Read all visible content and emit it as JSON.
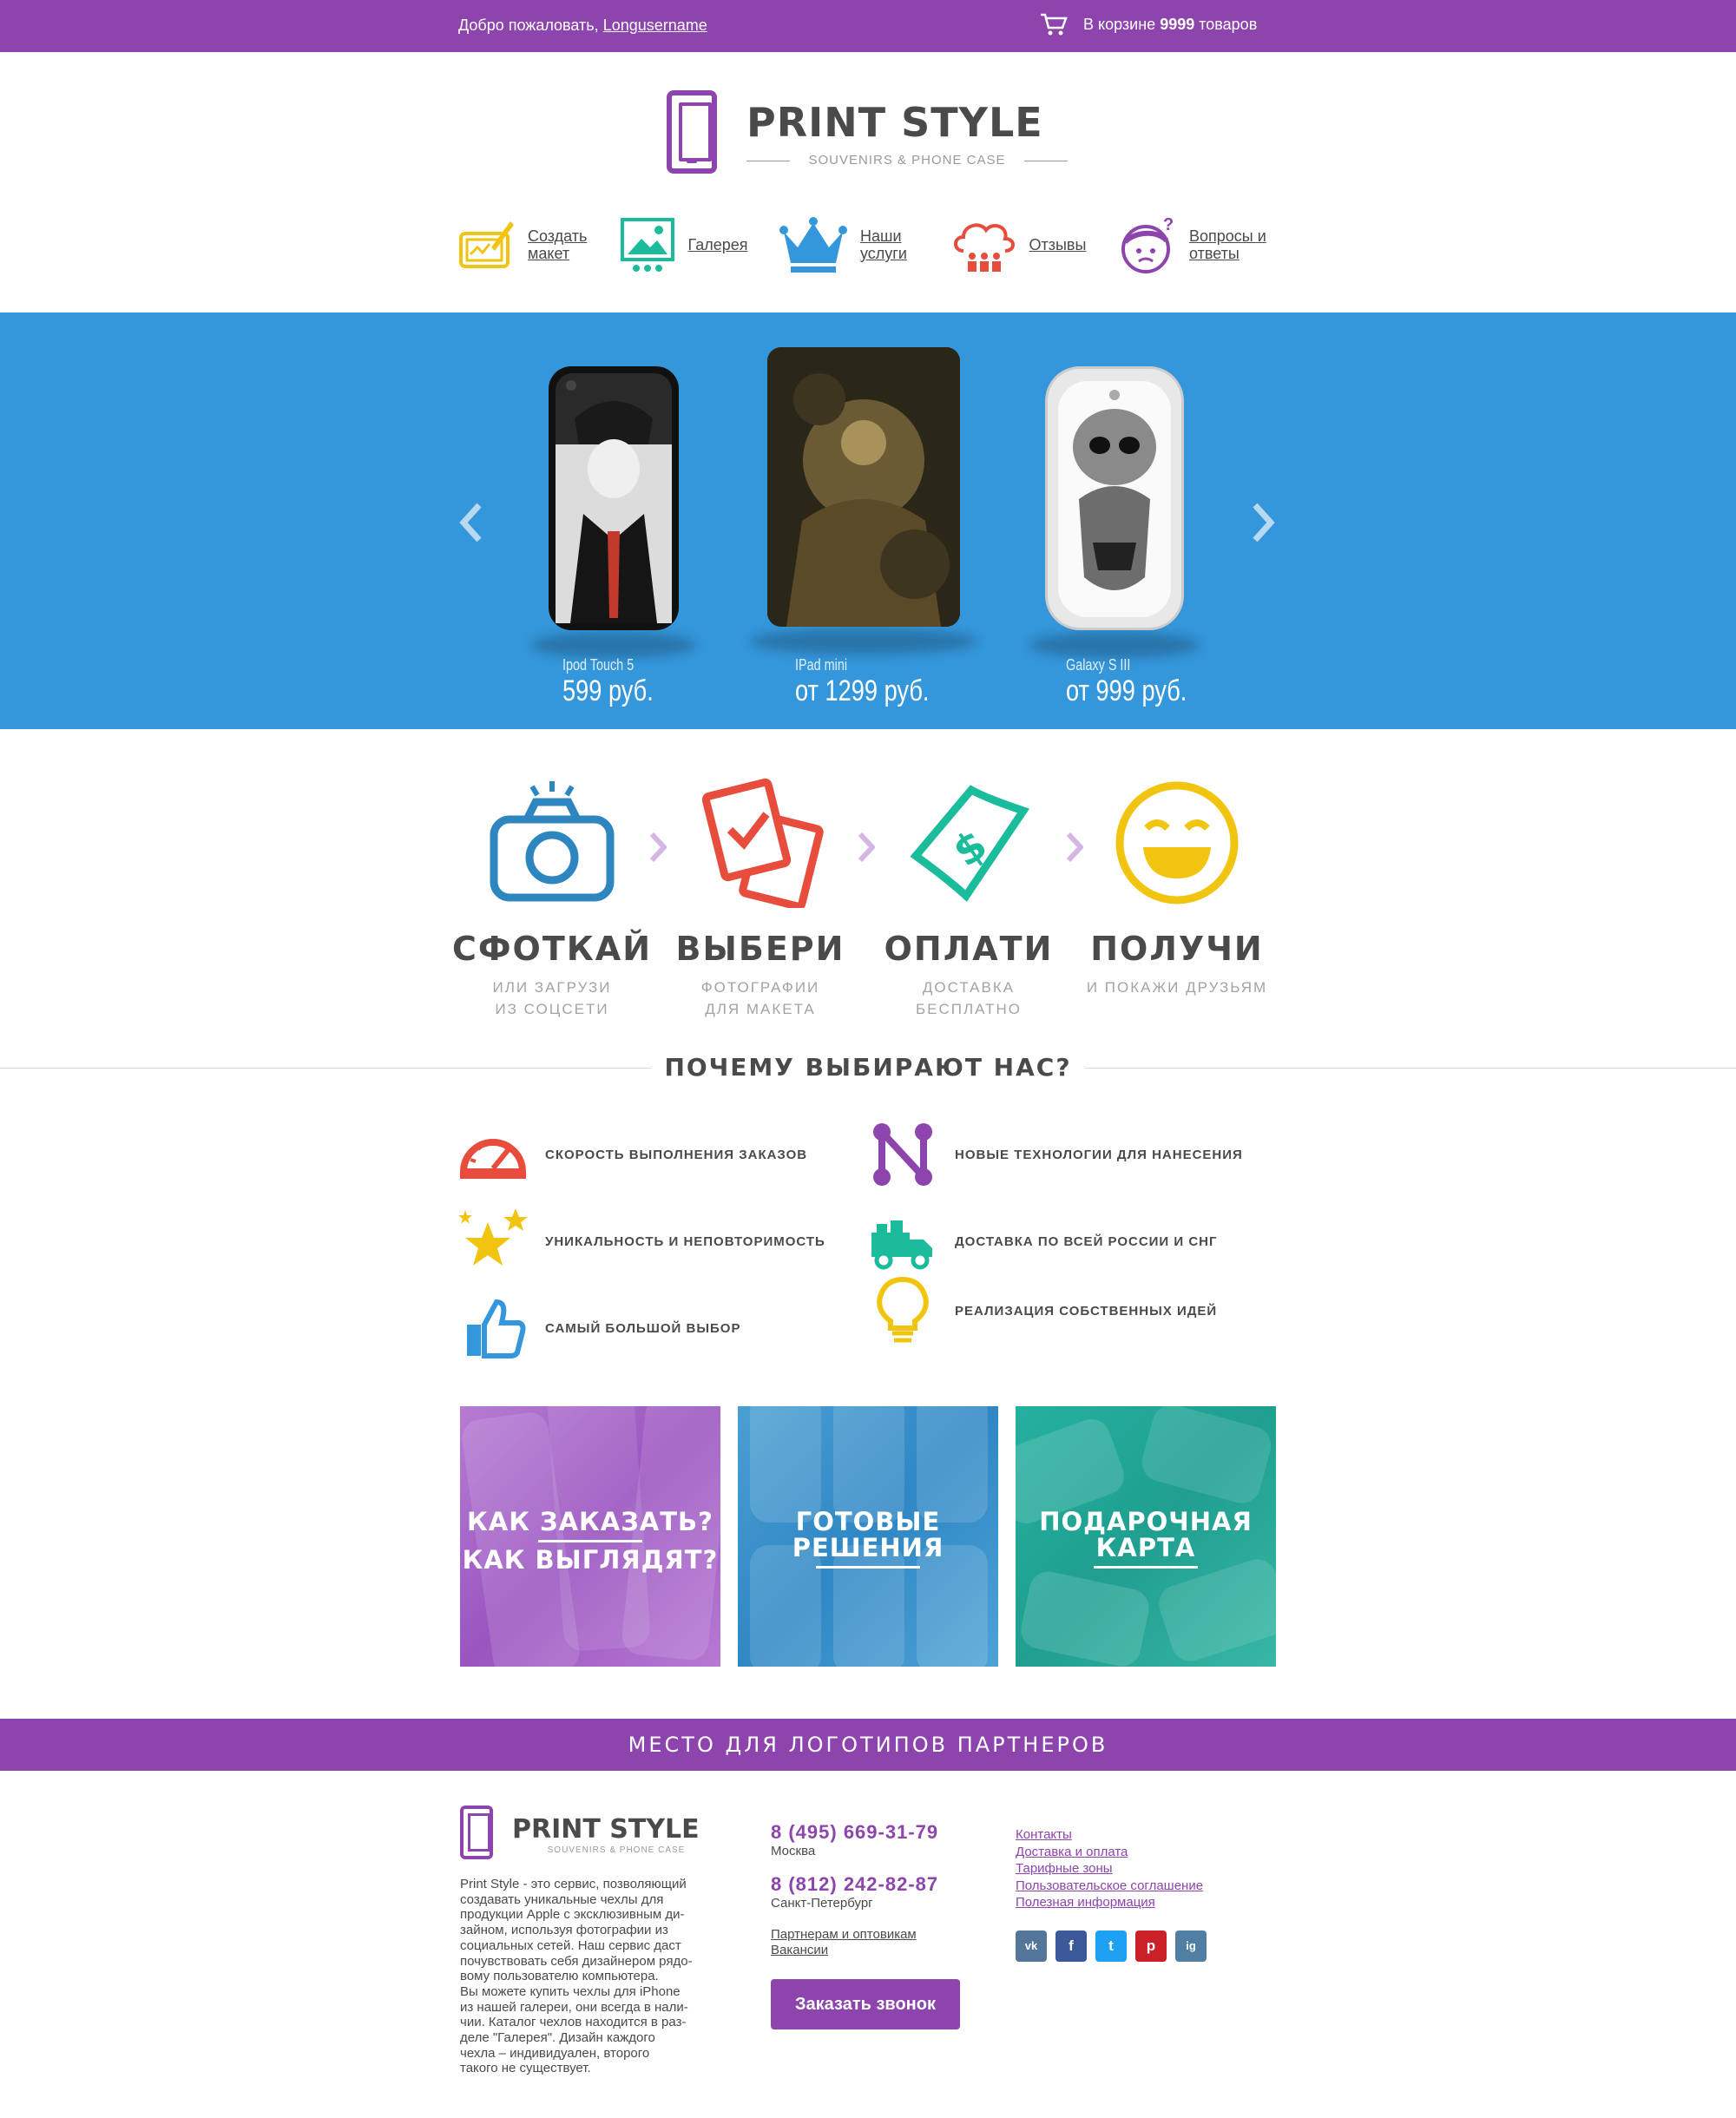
{
  "topbar": {
    "welcome": "Добро пожаловать,",
    "username": "Longusername",
    "cart_prefix": "В корзине",
    "cart_count": "9999",
    "cart_suffix": "товаров"
  },
  "logo": {
    "name": "PRINT STYLE",
    "tagline": "SOUVENIRS & PHONE CASE"
  },
  "nav": [
    {
      "label": "Создать макет",
      "icon": "tablet-draw-icon"
    },
    {
      "label": "Галерея",
      "icon": "gallery-icon"
    },
    {
      "label": "Наши услуги",
      "icon": "crown-icon"
    },
    {
      "label": "Отзывы",
      "icon": "cloud-people-icon"
    },
    {
      "label": "Вопросы и ответы",
      "icon": "question-face-icon"
    }
  ],
  "slider": {
    "products": [
      {
        "name": "Ipod Touch 5",
        "price": "599 руб."
      },
      {
        "name": "IPad mini",
        "price": "от 1299 руб."
      },
      {
        "name": "Galaxy S III",
        "price": "от 999 руб."
      }
    ]
  },
  "steps": [
    {
      "title": "СФОТКАЙ",
      "sub1": "ИЛИ ЗАГРУЗИ",
      "sub2": "ИЗ СОЦСЕТИ",
      "icon": "camera-icon"
    },
    {
      "title": "ВЫБЕРИ",
      "sub1": "ФОТОГРАФИИ",
      "sub2": "ДЛЯ МАКЕТА",
      "icon": "photos-check-icon"
    },
    {
      "title": "ОПЛАТИ",
      "sub1": "ДОСТАВКА",
      "sub2": "БЕСПЛАТНО",
      "icon": "money-icon"
    },
    {
      "title": "ПОЛУЧИ",
      "sub1": "И ПОКАЖИ ДРУЗЬЯМ",
      "sub2": "",
      "icon": "smile-icon"
    }
  ],
  "why": {
    "title": "ПОЧЕМУ ВЫБИРАЮТ НАС?",
    "features": [
      {
        "text": "СКОРОСТЬ ВЫПОЛНЕНИЯ ЗАКАЗОВ",
        "icon": "speedometer-icon"
      },
      {
        "text": "НОВЫЕ ТЕХНОЛОГИИ ДЛЯ НАНЕСЕНИЯ",
        "icon": "network-icon"
      },
      {
        "text": "УНИКАЛЬНОСТЬ И НЕПОВТОРИМОСТЬ",
        "icon": "stars-icon"
      },
      {
        "text": "ДОСТАВКА ПО ВСЕЙ РОССИИ И СНГ",
        "icon": "truck-icon"
      },
      {
        "text": "САМЫЙ БОЛЬШОЙ ВЫБОР",
        "icon": "thumbs-up-icon"
      },
      {
        "text": "РЕАЛИЗАЦИЯ СОБСТВЕННЫХ ИДЕЙ",
        "icon": "lightbulb-icon"
      }
    ]
  },
  "tiles": [
    {
      "line1": "КАК ЗАКАЗАТЬ?",
      "line2": "КАК ВЫГЛЯДЯТ?"
    },
    {
      "line1": "ГОТОВЫЕ",
      "line2": "РЕШЕНИЯ"
    },
    {
      "line1": "ПОДАРОЧНАЯ",
      "line2": "КАРТА"
    }
  ],
  "partners": "МЕСТО ДЛЯ ЛОГОТИПОВ ПАРТНЕРОВ",
  "footer": {
    "description": "Print Style - это сервис, позволяющий\nсоздавать уникальные чехлы для\nпродукции Apple с эксклюзивным ди-\nзайном, используя фотографии из\nсоциальных сетей. Наш сервис даст\nпочувствовать себя дизайнером рядо-\nвому пользователю компьютера.\nВы можете купить чехлы для iPhone\nиз нашей галереи, они всегда в нали-\nчии. Каталог чехлов находится в раз-\nделе \"Галерея\". Дизайн каждого\nчехла – индивидуален, второго\nтакого не существует.",
    "phone1": "8 (495) 669-31-79",
    "city1": "Москва",
    "phone2": "8 (812) 242-82-87",
    "city2": "Санкт-Петербург",
    "link_partners": "Партнерам и оптовикам",
    "link_jobs": "Вакансии",
    "call_button": "Заказать звонок",
    "menu": [
      "Контакты",
      "Доставка и оплата",
      "Тарифные зоны",
      "Пользовательское соглашение",
      "Полезная информация"
    ],
    "social": [
      {
        "label": "vk",
        "icon": "vk-icon",
        "color": "#54769a"
      },
      {
        "label": "f",
        "icon": "facebook-icon",
        "color": "#3b5998"
      },
      {
        "label": "t",
        "icon": "twitter-icon",
        "color": "#1da1f2"
      },
      {
        "label": "p",
        "icon": "pinterest-icon",
        "color": "#cb2027"
      },
      {
        "label": "ig",
        "icon": "instagram-icon",
        "color": "#517fa4"
      }
    ]
  },
  "colors": {
    "brand": "#8d44ad",
    "slider_bg": "#3496db",
    "text": "#4a4a4a"
  }
}
